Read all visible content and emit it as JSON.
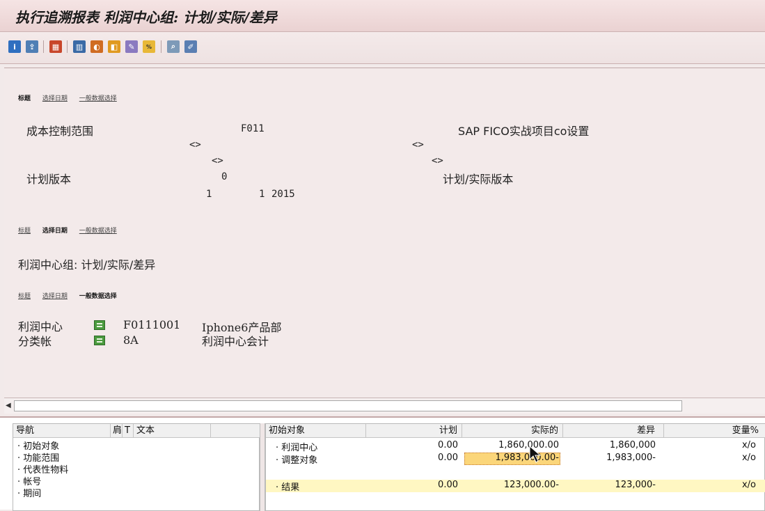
{
  "window": {
    "title": "执行追溯报表 利润中心组: 计划/实际/差异"
  },
  "toolbar": {
    "icons": [
      "info-icon",
      "export-icon",
      "filter-icon",
      "layout-icon",
      "graphic-icon",
      "select-icon",
      "edit-icon",
      "hundred-icon",
      "find-icon",
      "change-icon"
    ]
  },
  "tabs1": {
    "t1": "标题",
    "t2": "选择日期",
    "t3": "一般数据选择"
  },
  "header_block": {
    "label_area": "成本控制范围",
    "value_area": "F011",
    "desc_area": "SAP FICO实战项目co设置",
    "ph1": "<>",
    "ph2": "<>",
    "ph3": "<>",
    "ph4": "<>",
    "label_version": "计划版本",
    "value_version": "0",
    "desc_version": "计划/实际版本",
    "period_from": "1",
    "period_to": "1",
    "year": "2015"
  },
  "tabs2": {
    "t1": "标题",
    "t2": "选择日期",
    "t3": "一般数据选择"
  },
  "report_title": "利润中心组: 计划/实际/差异",
  "tabs3": {
    "t1": "标题",
    "t2": "选择日期",
    "t3": "一般数据选择"
  },
  "selection": {
    "row1_label": "利润中心",
    "row1_value": "F0111001",
    "row1_desc": "Iphone6产品部",
    "row2_label": "分类帐",
    "row2_value": "8A",
    "row2_desc": "利润中心会计"
  },
  "nav": {
    "col_title": "导航",
    "col_a": "肩",
    "col_b": "T",
    "col_text": "文本",
    "items": [
      "初始对象",
      "功能范围",
      "代表性物料",
      "帐号",
      "期间"
    ]
  },
  "results": {
    "headers": {
      "object": "初始对象",
      "plan": "计划",
      "actual": "实际的",
      "diff": "差异",
      "pct": "变量%"
    },
    "rows": [
      {
        "object": "利润中心",
        "plan": "0.00",
        "actual": "1,860,000.00",
        "diff": "1,860,000",
        "pct": "x/o"
      },
      {
        "object": "调整对象",
        "plan": "0.00",
        "actual": "1,983,000.00-",
        "diff": "1,983,000-",
        "pct": "x/o"
      },
      {
        "object": "结果",
        "plan": "0.00",
        "actual": "123,000.00-",
        "diff": "123,000-",
        "pct": "x/o"
      }
    ]
  }
}
